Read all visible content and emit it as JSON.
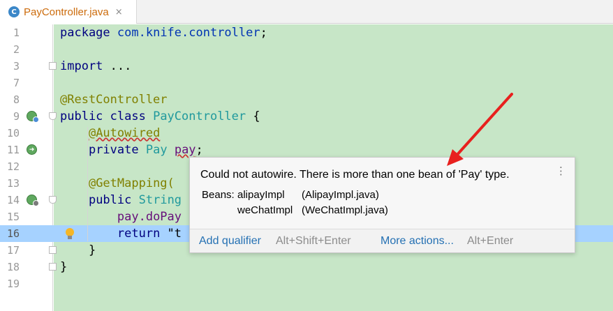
{
  "tab": {
    "icon_letter": "C",
    "file_name": "PayController.java",
    "close_glyph": "×"
  },
  "line_numbers": [
    "1",
    "2",
    "3",
    "7",
    "8",
    "9",
    "10",
    "11",
    "12",
    "13",
    "14",
    "15",
    "16",
    "17",
    "18",
    "19"
  ],
  "current_line": "16",
  "code": {
    "line1_kw": "package",
    "line1_pkg": "com.knife.controller",
    "line1_end": ";",
    "line3_kw": "import",
    "line3_rest": " ...",
    "line8_ann": "@RestController",
    "line9_kw": "public class",
    "line9_type": "PayController",
    "line9_end": " {",
    "line10_ann": "@Autowired",
    "line11_kw": "private",
    "line11_type": "Pay",
    "line11_ident": "pay",
    "line11_end": ";",
    "line13_ann": "@GetMapping(",
    "line14_kw": "public",
    "line14_type": "String",
    "line15_text": "pay.doPay",
    "line16_kw": "return",
    "line16_rest": " \"t",
    "line17_text": "}",
    "line18_text": "}"
  },
  "popup": {
    "message": "Could not autowire. There is more than one bean of 'Pay' type.",
    "more_glyph": "⋮",
    "beans_label": "Beans:",
    "beans": [
      {
        "name": "alipayImpl",
        "file": "(AlipayImpl.java)"
      },
      {
        "name": "weChatImpl",
        "file": "(WeChatImpl.java)"
      }
    ],
    "action_primary": "Add qualifier",
    "action_primary_shortcut": "Alt+Shift+Enter",
    "action_more": "More actions...",
    "action_more_shortcut": "Alt+Enter"
  },
  "colors": {
    "editor_bg": "#c7e6c7",
    "selection": "#a6d2ff",
    "annotation_arrow": "#e8201e",
    "link": "#2470b3"
  }
}
